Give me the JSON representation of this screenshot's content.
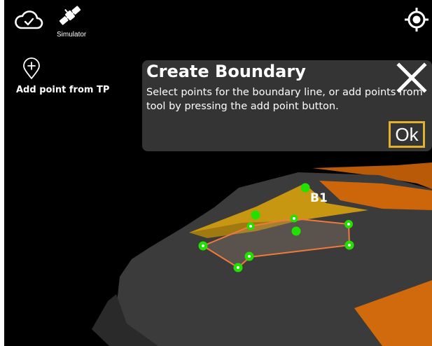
{
  "toolbar": {
    "cloud_icon": "cloud-check-icon",
    "simulator_icon": "satellite-icon",
    "simulator_label": "Simulator",
    "locate_icon": "location-target-icon"
  },
  "side_panel": {
    "add_point_icon": "map-pin-plus-icon",
    "add_point_label": "Add point from TP"
  },
  "dialog": {
    "title": "Create Boundary",
    "message": "Select points for the boundary line, or add points from tool by pressing the add point button.",
    "close_icon": "close-icon",
    "ok_label": "Ok",
    "ok_border_color": "#e2b12f"
  },
  "scene": {
    "boundary_label": "B1",
    "colors": {
      "background": "#000000",
      "surface": "#3a3a3a",
      "terrain_orange": "#c8640a",
      "terrain_yellow": "#c89a10",
      "boundary_line": "#f07a3a",
      "point": "#22e000"
    }
  }
}
